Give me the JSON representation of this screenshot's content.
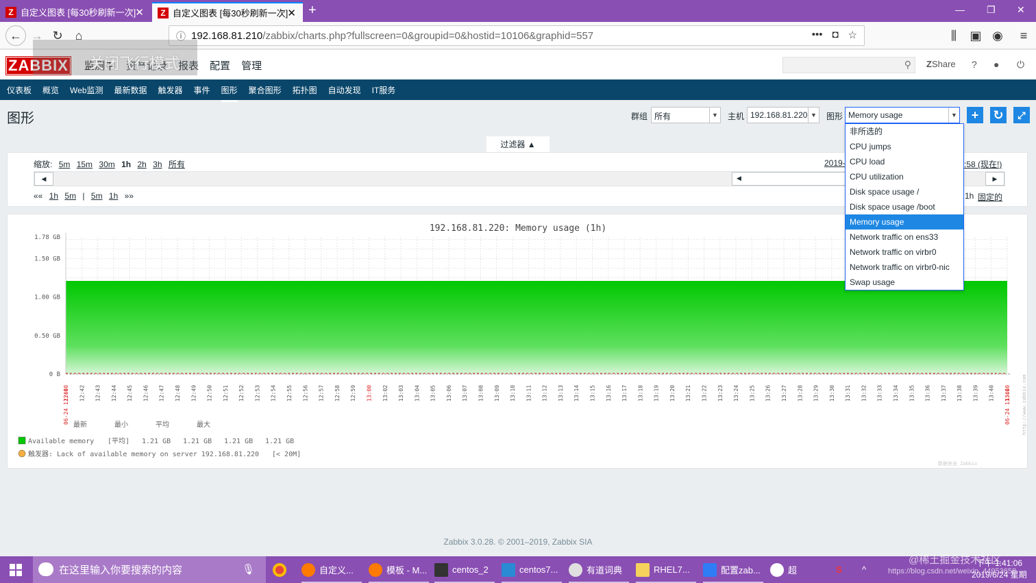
{
  "browser": {
    "tabs": [
      {
        "label": "自定义图表 [每30秒刷新一次]"
      },
      {
        "label": "自定义图表 [每30秒刷新一次]"
      }
    ],
    "url_host": "192.168.81.210",
    "url_path": "/zabbix/charts.php?fullscreen=0&groupid=0&hostid=10106&graphid=557",
    "overlay_text": "关闭飞行模式"
  },
  "zabbix": {
    "logo": "ZABBIX",
    "main_menu": [
      "监测中",
      "资产记录",
      "报表",
      "配置",
      "管理"
    ],
    "share_label": "Share",
    "help_label": "?",
    "sub_menu": [
      "仪表板",
      "概览",
      "Web监测",
      "最新数据",
      "触发器",
      "事件",
      "图形",
      "聚合图形",
      "拓扑图",
      "自动发现",
      "IT服务"
    ],
    "page_title": "图形",
    "filter": {
      "group_label": "群组",
      "group_value": "所有",
      "host_label": "主机",
      "host_value": "192.168.81.220",
      "graph_label": "图形",
      "graph_value": "Memory usage"
    },
    "filter_tab": "过滤器 ▲",
    "zoom_label": "缩放:",
    "zoom_options": [
      "5m",
      "15m",
      "30m",
      "1h",
      "2h",
      "3h",
      "所有"
    ],
    "nav_left": [
      "««",
      "1h",
      "5m",
      "|",
      "5m",
      "1h",
      "»»"
    ],
    "date_left": "2019-",
    "date_right": ":58 (现在!)",
    "nav_right_1h": "1h",
    "nav_right_fixed": "固定的",
    "graph_options": [
      "非所选的",
      "CPU jumps",
      "CPU load",
      "CPU utilization",
      "Disk space usage /",
      "Disk space usage /boot",
      "Memory usage",
      "Network traffic on ens33",
      "Network traffic on virbr0",
      "Network traffic on virbr0-nic",
      "Swap usage"
    ],
    "footer": "Zabbix 3.0.28. © 2001–2019, Zabbix SIA"
  },
  "chart_data": {
    "type": "area",
    "title": "192.168.81.220: Memory usage (1h)",
    "y_ticks": [
      "0 B",
      "0.50 GB",
      "1.00 GB",
      "1.50 GB",
      "1.78 GB"
    ],
    "ylim": [
      0,
      1.78
    ],
    "y_unit": "GB",
    "x_ticks": [
      "12:40",
      "12:42",
      "12:43",
      "12:44",
      "12:45",
      "12:46",
      "12:47",
      "12:48",
      "12:49",
      "12:50",
      "12:51",
      "12:52",
      "12:53",
      "12:54",
      "12:55",
      "12:56",
      "12:57",
      "12:58",
      "12:59",
      "13:00",
      "13:02",
      "13:03",
      "13:04",
      "13:05",
      "13:06",
      "13:07",
      "13:08",
      "13:09",
      "13:10",
      "13:11",
      "13:12",
      "13:13",
      "13:14",
      "13:15",
      "13:16",
      "13:17",
      "13:18",
      "13:19",
      "13:20",
      "13:21",
      "13:22",
      "13:23",
      "13:24",
      "13:25",
      "13:26",
      "13:27",
      "13:28",
      "13:29",
      "13:30",
      "13:31",
      "13:32",
      "13:33",
      "13:34",
      "13:35",
      "13:36",
      "13:37",
      "13:38",
      "13:39",
      "13:40",
      "13:40"
    ],
    "date_start": "06-24 12:40",
    "date_end": "06-24 13:40",
    "series": [
      {
        "name": "Available memory",
        "values": [
          1.21,
          1.21,
          1.21,
          1.21,
          1.21,
          1.21,
          1.21,
          1.21,
          1.21,
          1.21
        ],
        "color": "#00c800"
      }
    ],
    "legend": {
      "headers": [
        "最新",
        "最小",
        "平均",
        "最大"
      ],
      "item_name": "Available memory",
      "item_func": "[平均]",
      "item_values": [
        "1.21 GB",
        "1.21 GB",
        "1.21 GB",
        "1.21 GB"
      ],
      "trigger": "触发器: Lack of available memory on server 192.168.81.220",
      "trigger_cond": "[< 20M]"
    },
    "side_text": "http://www.zabbix.com",
    "corner_text": "数据来自 Zabbix"
  },
  "taskbar": {
    "search_placeholder": "在这里输入你要搜索的内容",
    "items": [
      "自定义...",
      "模板 - M...",
      "centos_2",
      "centos7...",
      "有道词典",
      "RHEL7...",
      "配置zab...",
      "超"
    ],
    "time": "下午 1:41:06",
    "date": "2019/6/24 星期",
    "watermark": "@稀土掘金技术社区",
    "watermark2": "https://blog.csdn.net/weixin_44953658"
  }
}
